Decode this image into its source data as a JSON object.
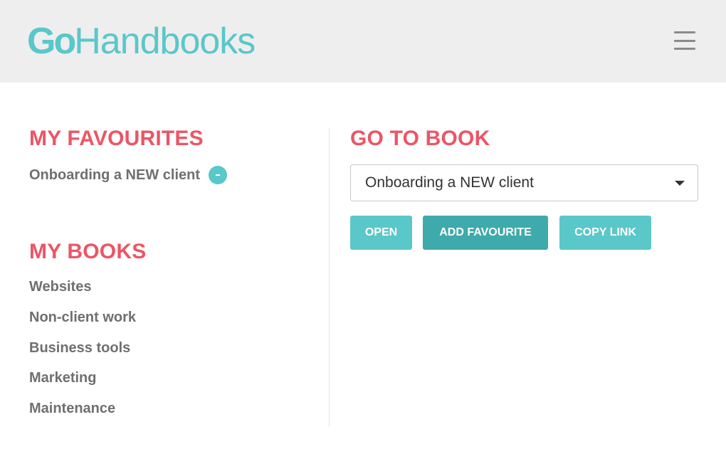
{
  "header": {
    "logo_bold": "Go",
    "logo_light": "Handbooks",
    "menu_icon": "hamburger-menu-icon"
  },
  "favourites": {
    "heading": "MY FAVOURITES",
    "items": [
      {
        "label": "Onboarding a NEW client",
        "remove_icon": "minus-circle-icon"
      }
    ]
  },
  "books": {
    "heading": "MY BOOKS",
    "items": [
      "Websites",
      "Non-client work",
      "Business tools",
      "Marketing",
      "Maintenance"
    ]
  },
  "go_to_book": {
    "heading": "GO TO BOOK",
    "selected": "Onboarding a NEW client",
    "buttons": {
      "open": "OPEN",
      "add_favourite": "ADD FAVOURITE",
      "copy_link": "COPY LINK"
    }
  },
  "colors": {
    "accent": "#5ac7c9",
    "accent_dark": "#3eaaab",
    "heading": "#ec5565",
    "header_bg": "#eeeeee"
  }
}
